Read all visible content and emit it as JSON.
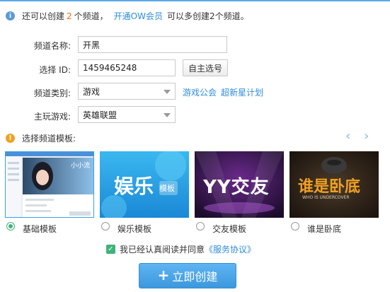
{
  "notice": {
    "prefix": "还可以创建",
    "count": "2",
    "suffix": "个频道，",
    "link": "开通OW会员",
    "tail": "可以多创建2个频道。"
  },
  "form": {
    "name_label": "频道名称:",
    "name_value": "开黑",
    "id_label": "选择 ID:",
    "id_value": "1459465248",
    "id_button": "自主选号",
    "category_label": "频道类别:",
    "category_value": "游戏",
    "category_links": [
      "游戏公会",
      "超新星计划"
    ],
    "game_label": "主玩游戏:",
    "game_value": "英雄联盟"
  },
  "templates": {
    "heading": "选择频道模板:",
    "prev_arrow": "‹",
    "next_arrow": "›",
    "items": [
      {
        "label": "基础模板",
        "thumb_text": "小小流",
        "selected": true
      },
      {
        "label": "娱乐模板",
        "thumb_text": "娱乐",
        "thumb_sub": "模板",
        "selected": false
      },
      {
        "label": "交友模板",
        "thumb_text": "YY交友",
        "selected": false
      },
      {
        "label": "谁是卧底",
        "thumb_text": "谁是卧底",
        "thumb_sub": "WHO IS UNDERCOVER",
        "selected": false
      }
    ]
  },
  "agreement": {
    "text": "我已经认真阅读并同意",
    "link": "《服务协议》",
    "checked": true
  },
  "submit": {
    "label": "立即创建",
    "icon": "plus-icon"
  },
  "colors": {
    "accent": "#3c98de",
    "link": "#2d8cdf",
    "count": "#ff6600",
    "check": "#3fb37a"
  }
}
